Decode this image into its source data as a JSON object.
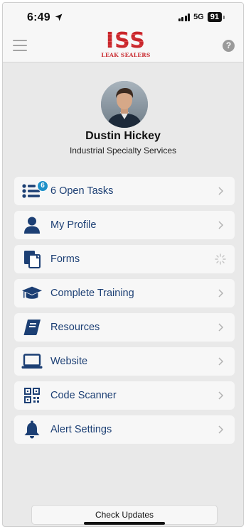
{
  "status": {
    "time": "6:49",
    "network": "5G",
    "battery": "91"
  },
  "header": {
    "logo_main": "ISS",
    "logo_sub": "LEAK SEALERS"
  },
  "profile": {
    "name": "Dustin Hickey",
    "company": "Industrial Specialty Services"
  },
  "menu": [
    {
      "label": "6 Open Tasks",
      "icon": "task-list-icon",
      "badge": "6"
    },
    {
      "label": "My Profile",
      "icon": "person-icon"
    },
    {
      "label": "Forms",
      "icon": "forms-icon",
      "loading": true
    },
    {
      "label": "Complete Training",
      "icon": "graduation-cap-icon"
    },
    {
      "label": "Resources",
      "icon": "book-icon"
    },
    {
      "label": "Website",
      "icon": "laptop-icon"
    },
    {
      "label": "Code Scanner",
      "icon": "qr-code-icon"
    },
    {
      "label": "Alert Settings",
      "icon": "bell-icon"
    }
  ],
  "footer": {
    "check_updates_label": "Check Updates"
  },
  "colors": {
    "accent": "#1c3f74",
    "brand_red": "#c8262b",
    "badge": "#1e90c8",
    "background": "#e9e9e9"
  }
}
